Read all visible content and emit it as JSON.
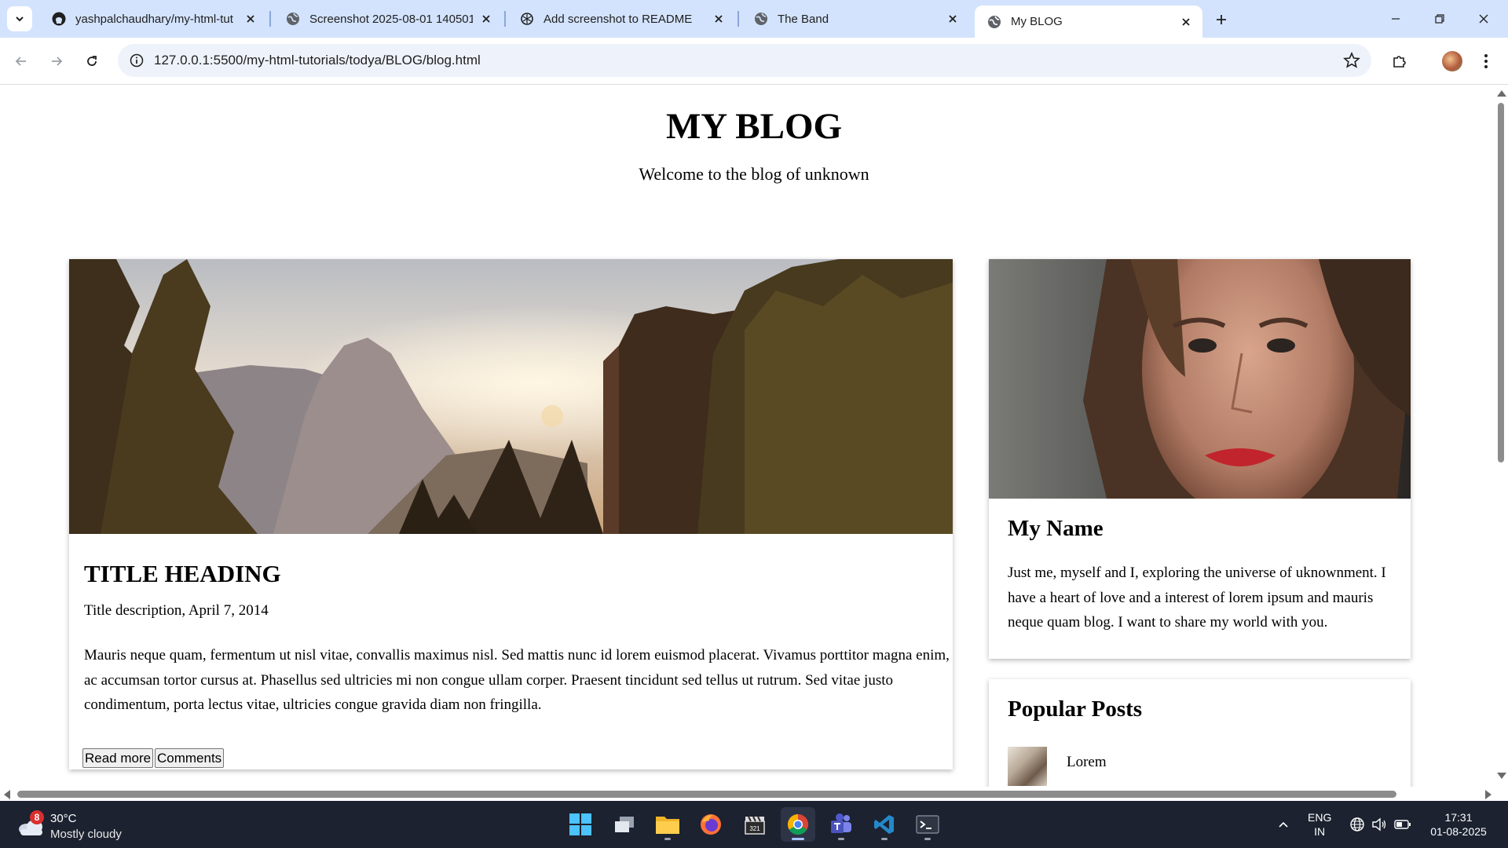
{
  "browser": {
    "tabs": [
      {
        "title": "yashpalchaudhary/my-html-tut",
        "icon": "github-icon",
        "active": false
      },
      {
        "title": "Screenshot 2025-08-01 140501",
        "icon": "globe-icon",
        "active": false
      },
      {
        "title": "Add screenshot to README",
        "icon": "openai-icon",
        "active": false
      },
      {
        "title": "The Band",
        "icon": "globe-icon",
        "active": false
      },
      {
        "title": "My BLOG",
        "icon": "globe-icon",
        "active": true
      }
    ],
    "url": "127.0.0.1:5500/my-html-tutorials/todya/BLOG/blog.html"
  },
  "page": {
    "header": {
      "title": "MY BLOG",
      "subtitle": "Welcome to the blog of unknown"
    },
    "post": {
      "image": "mountain-sunset-photo",
      "title": "TITLE HEADING",
      "meta": "Title description, April 7, 2014",
      "body": "Mauris neque quam, fermentum ut nisl vitae, convallis maximus nisl. Sed mattis nunc id lorem euismod placerat. Vivamus porttitor magna enim, ac accumsan tortor cursus at. Phasellus sed ultricies mi non congue ullam corper. Praesent tincidunt sed tellus ut rutrum. Sed vitae justo condimentum, porta lectus vitae, ultricies congue gravida diam non fringilla.",
      "read_more": "Read more",
      "comments": "Comments"
    },
    "about": {
      "image": "woman-portrait-photo",
      "name": "My Name",
      "text": "Just me, myself and I, exploring the universe of uknownment. I have a heart of love and a interest of lorem ipsum and mauris neque quam blog. I want to share my world with you."
    },
    "popular": {
      "title": "Popular Posts",
      "items": [
        {
          "label": "Lorem",
          "thumb": "workspace-photo"
        }
      ]
    }
  },
  "taskbar": {
    "weather": {
      "badge": "8",
      "temp": "30°C",
      "condition": "Mostly cloudy"
    },
    "apps": [
      "windows-start-icon",
      "task-view-icon",
      "file-explorer-icon",
      "firefox-icon",
      "clapperboard-app-icon",
      "chrome-icon",
      "teams-icon",
      "vscode-icon",
      "terminal-icon"
    ],
    "language": {
      "line1": "ENG",
      "line2": "IN"
    },
    "time": "17:31",
    "date": "01-08-2025"
  },
  "colors": {
    "tabstrip": "#d3e3fd",
    "taskbar": "#1c2230",
    "accent": "#1a73e8"
  }
}
